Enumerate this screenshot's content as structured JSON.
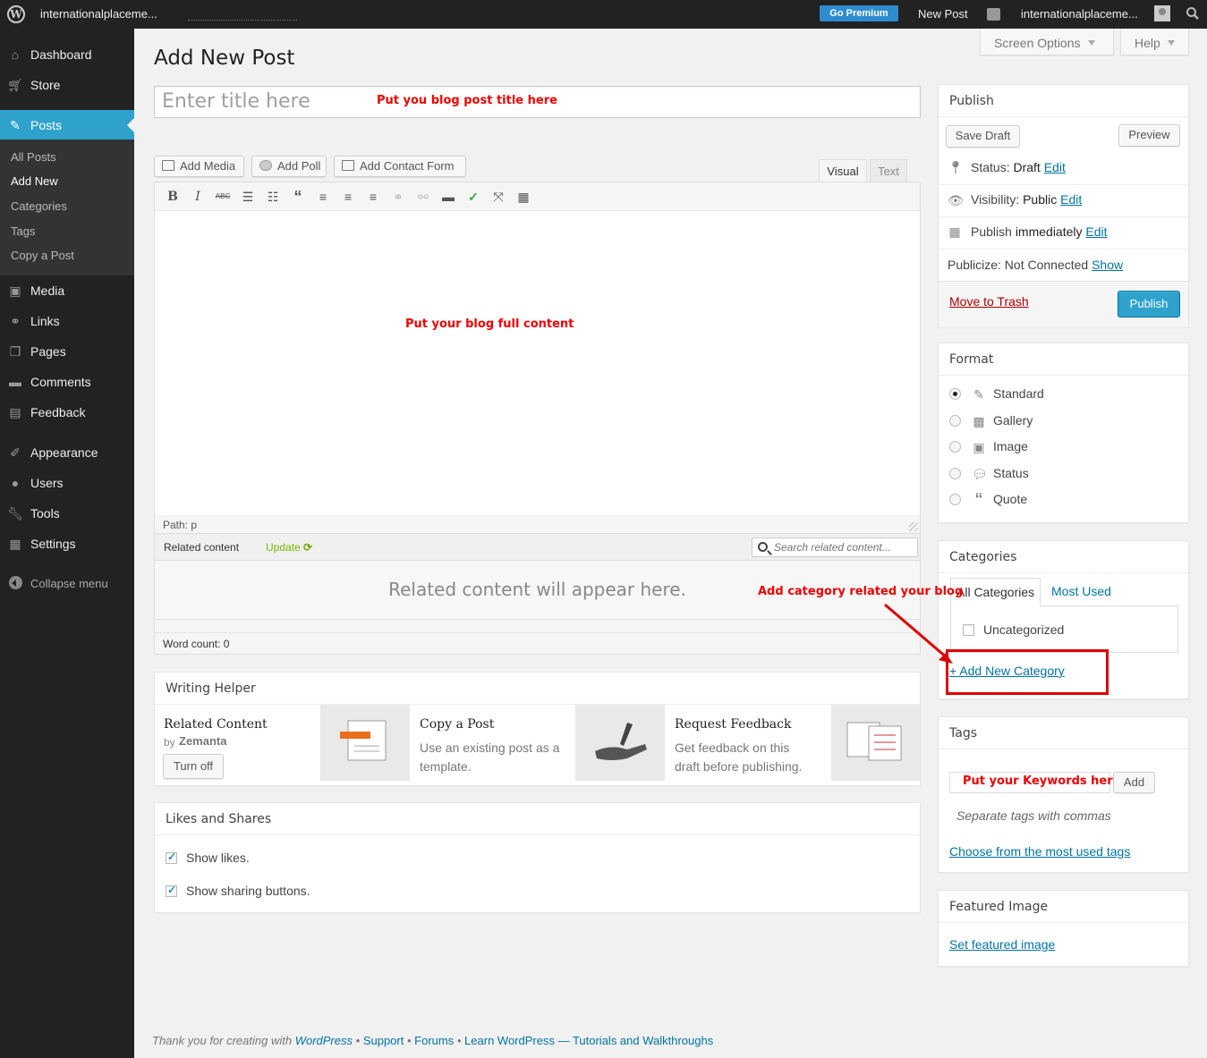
{
  "adminbar": {
    "site_name": "internationalplaceme...",
    "go_premium": "Go Premium",
    "new_post": "New Post",
    "account": "internationalplaceme..."
  },
  "sidebar": {
    "dashboard": "Dashboard",
    "store": "Store",
    "posts": "Posts",
    "submenu": {
      "all_posts": "All Posts",
      "add_new": "Add New",
      "categories": "Categories",
      "tags": "Tags",
      "copy_post": "Copy a Post"
    },
    "media": "Media",
    "links": "Links",
    "pages": "Pages",
    "comments": "Comments",
    "feedback": "Feedback",
    "appearance": "Appearance",
    "users": "Users",
    "tools": "Tools",
    "settings": "Settings",
    "collapse": "Collapse menu"
  },
  "header": {
    "screen_options": "Screen Options",
    "help": "Help",
    "title": "Add New Post"
  },
  "editor": {
    "title_placeholder": "Enter title here",
    "add_media": "Add Media",
    "add_poll": "Add Poll",
    "add_contact_form": "Add Contact Form",
    "tab_visual": "Visual",
    "tab_text": "Text",
    "path": "Path: p"
  },
  "annotations": {
    "title_hint": "Put you blog post title here",
    "content_hint": "Put your blog full content",
    "category_hint": "Add category related your blog",
    "keywords_hint": "Put your Keywords here"
  },
  "related": {
    "label": "Related content",
    "update": "Update",
    "search_placeholder": "Search related content...",
    "empty": "Related content will appear here.",
    "word_count": "Word count: 0"
  },
  "writing_helper": {
    "title": "Writing Helper",
    "related_title": "Related Content",
    "by": "by",
    "zemanta": "Zemanta",
    "turn_off": "Turn off",
    "copy_title": "Copy a Post",
    "copy_desc_1": "Use an existing post as a",
    "copy_desc_2": "template.",
    "feedback_title": "Request Feedback",
    "feedback_desc_1": "Get feedback on this",
    "feedback_desc_2": "draft before publishing."
  },
  "likes": {
    "title": "Likes and Shares",
    "show_likes": "Show likes.",
    "show_sharing": "Show sharing buttons."
  },
  "publish": {
    "title": "Publish",
    "save_draft": "Save Draft",
    "preview": "Preview",
    "status_label": "Status:",
    "status_value": "Draft",
    "visibility_label": "Visibility:",
    "visibility_value": "Public",
    "publish_label": "Publish",
    "publish_value": "immediately",
    "edit": "Edit",
    "publicize": "Publicize: Not Connected",
    "show": "Show",
    "trash": "Move to Trash",
    "publish_button": "Publish"
  },
  "format": {
    "title": "Format",
    "options": [
      "Standard",
      "Gallery",
      "Image",
      "Status",
      "Quote"
    ],
    "selected": "Standard"
  },
  "categories": {
    "title": "Categories",
    "tab_all": "All Categories",
    "tab_most_used": "Most Used",
    "item": "Uncategorized",
    "add_new": "+ Add New Category"
  },
  "tags": {
    "title": "Tags",
    "add": "Add",
    "hint": "Separate tags with commas",
    "choose": "Choose from the most used tags"
  },
  "featured": {
    "title": "Featured Image",
    "set": "Set featured image"
  },
  "footer": {
    "thanks": "Thank you for creating with",
    "wordpress": "WordPress",
    "sep": "•",
    "support": "Support",
    "forums": "Forums",
    "learn": "Learn WordPress — Tutorials and Walkthroughs"
  }
}
